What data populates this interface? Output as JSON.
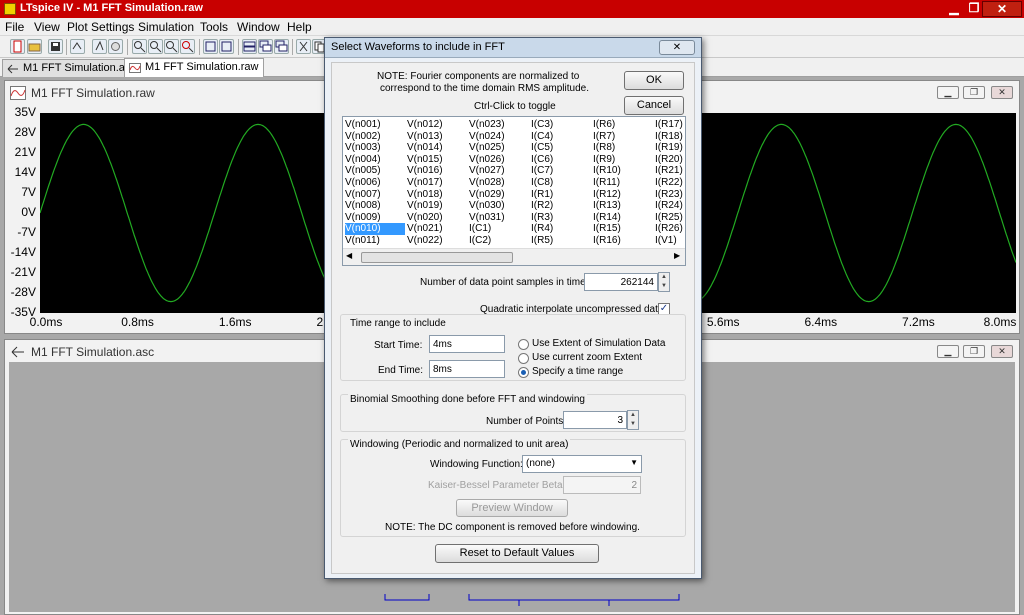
{
  "app": {
    "title": "LTspice IV - M1 FFT Simulation.raw",
    "window_controls": {
      "minimize": "▁",
      "maximize": "❐",
      "close": "✕"
    }
  },
  "menu": [
    "File",
    "View",
    "Plot Settings",
    "Simulation",
    "Tools",
    "Window",
    "Help"
  ],
  "toolbar_icons": [
    "new-icon",
    "open-icon",
    "save-icon",
    "control-panel-icon",
    "run-icon",
    "halt-icon",
    "zoom-in-icon",
    "zoom-out-icon",
    "zoom-fit-icon",
    "zoom-cancel-icon",
    "autorange-icon",
    "plot-icon",
    "tile-icon",
    "cascade-icon",
    "cut-icon",
    "copy-icon"
  ],
  "tabs": [
    {
      "label": "M1 FFT Simulation.asc",
      "active": false
    },
    {
      "label": "M1 FFT Simulation.raw",
      "active": true
    }
  ],
  "waveform_window": {
    "title": "M1 FFT Simulation.raw",
    "trace_color": "#22aa22"
  },
  "chart_data": {
    "type": "line",
    "title": "",
    "xlabel": "",
    "ylabel": "",
    "xlim": [
      0.0,
      8.0
    ],
    "ylim": [
      -35,
      35
    ],
    "x_ticks": [
      "0.0ms",
      "0.8ms",
      "1.6ms",
      "2.4ms",
      "3.2ms",
      "4.0ms",
      "4.8ms",
      "5.6ms",
      "6.4ms",
      "7.2ms",
      "8.0ms"
    ],
    "y_ticks": [
      "35V",
      "28V",
      "21V",
      "14V",
      "7V",
      "0V",
      "-7V",
      "-14V",
      "-21V",
      "-28V",
      "-35V"
    ],
    "grid": false,
    "series": [
      {
        "amplitude": 31,
        "period": 1.43,
        "phase": 0.0
      }
    ]
  },
  "schematic_window": {
    "title": "M1 FFT Simulation.asc"
  },
  "dialog": {
    "title": "Select Waveforms to include in FFT",
    "close_label": "✕",
    "note_line1": "NOTE:  Fourier components are normalized to",
    "note_line2": "correspond to the time domain RMS amplitude.",
    "ctrl_hint": "Ctrl-Click to toggle",
    "ok": "OK",
    "cancel": "Cancel",
    "waveform_columns": [
      [
        "V(n001)",
        "V(n002)",
        "V(n003)",
        "V(n004)",
        "V(n005)",
        "V(n006)",
        "V(n007)",
        "V(n008)",
        "V(n009)",
        "V(n010)",
        "V(n011)"
      ],
      [
        "V(n012)",
        "V(n013)",
        "V(n014)",
        "V(n015)",
        "V(n016)",
        "V(n017)",
        "V(n018)",
        "V(n019)",
        "V(n020)",
        "V(n021)",
        "V(n022)"
      ],
      [
        "V(n023)",
        "V(n024)",
        "V(n025)",
        "V(n026)",
        "V(n027)",
        "V(n028)",
        "V(n029)",
        "V(n030)",
        "V(n031)",
        "I(C1)",
        "I(C2)"
      ],
      [
        "I(C3)",
        "I(C4)",
        "I(C5)",
        "I(C6)",
        "I(C7)",
        "I(C8)",
        "I(R1)",
        "I(R2)",
        "I(R3)",
        "I(R4)",
        "I(R5)"
      ],
      [
        "I(R6)",
        "I(R7)",
        "I(R8)",
        "I(R9)",
        "I(R10)",
        "I(R11)",
        "I(R12)",
        "I(R13)",
        "I(R14)",
        "I(R15)",
        "I(R16)"
      ],
      [
        "I(R17)",
        "I(R18)",
        "I(R19)",
        "I(R20)",
        "I(R21)",
        "I(R22)",
        "I(R23)",
        "I(R24)",
        "I(R25)",
        "I(R26)",
        "I(V1)"
      ]
    ],
    "selected_waveform": "V(n010)",
    "samples_label": "Number of data point samples in time:",
    "samples_value": "262144",
    "quadratic_label": "Quadratic interpolate uncompressed data",
    "quadratic_checked": true,
    "time_range": {
      "group_label": "Time range to include",
      "start_label": "Start Time:",
      "start_value": "4ms",
      "end_label": "End Time:",
      "end_value": "8ms",
      "options": [
        "Use Extent of Simulation Data",
        "Use current zoom Extent",
        "Specify a time range"
      ],
      "selected_option": "Specify a time range"
    },
    "smoothing": {
      "group_label": "Binomial Smoothing done before FFT and windowing",
      "points_label": "Number of Points:",
      "points_value": "3"
    },
    "windowing": {
      "group_label": "Windowing  (Periodic and normalized to unit area)",
      "function_label": "Windowing Function:",
      "function_value": "(none)",
      "beta_label": "Kaiser-Bessel Parameter Beta:",
      "beta_value": "2",
      "preview": "Preview Window",
      "note": "NOTE:  The DC component is removed before windowing."
    },
    "reset": "Reset to Default Values"
  }
}
